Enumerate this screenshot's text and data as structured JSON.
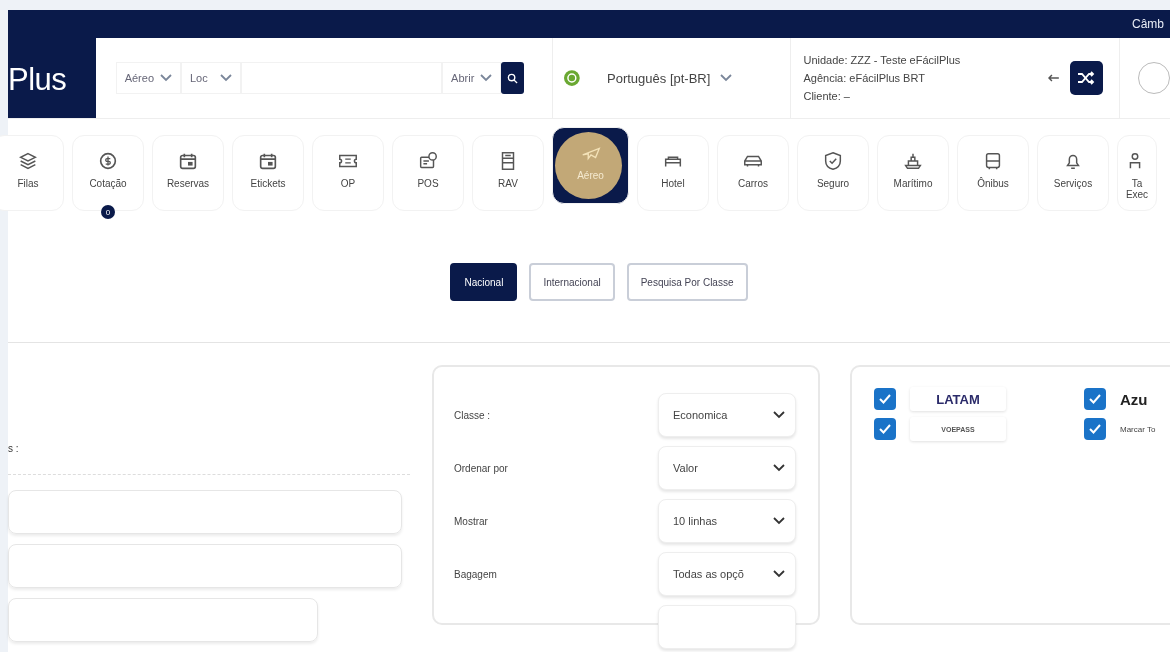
{
  "top_bar": {
    "right_text": "Câmb"
  },
  "logo": {
    "text": "Plus"
  },
  "search": {
    "type_select": "Aéreo",
    "field_select": "Loc",
    "action_select": "Abrir"
  },
  "language": {
    "value": "Português [pt-BR]"
  },
  "unit_info": {
    "unidade": "Unidade:  ZZZ - Teste eFácilPlus",
    "agencia": "Agência: eFácilPlus BRT",
    "cliente": "Cliente:  –"
  },
  "nav": [
    {
      "label": "Filas",
      "kind": "layers",
      "selected": false
    },
    {
      "label": "Cotação",
      "kind": "coin",
      "selected": false,
      "badge": "0"
    },
    {
      "label": "Reservas",
      "kind": "calendar",
      "selected": false
    },
    {
      "label": "Etickets",
      "kind": "calendar",
      "selected": false
    },
    {
      "label": "OP",
      "kind": "ticket",
      "selected": false
    },
    {
      "label": "POS",
      "kind": "pos",
      "selected": false
    },
    {
      "label": "RAV",
      "kind": "doc",
      "selected": false
    },
    {
      "label": "Aéreo",
      "kind": "plane",
      "selected": true
    },
    {
      "label": "Hotel",
      "kind": "bed",
      "selected": false
    },
    {
      "label": "Carros",
      "kind": "car",
      "selected": false
    },
    {
      "label": "Seguro",
      "kind": "shield",
      "selected": false
    },
    {
      "label": "Marítimo",
      "kind": "ship",
      "selected": false
    },
    {
      "label": "Ônibus",
      "kind": "bus",
      "selected": false
    },
    {
      "label": "Serviços",
      "kind": "bell",
      "selected": false
    },
    {
      "label": "Ta Exec",
      "kind": "person",
      "selected": false
    }
  ],
  "scope_tabs": [
    {
      "label": "Nacional",
      "selected": true
    },
    {
      "label": "Internacional",
      "selected": false
    },
    {
      "label": "Pesquisa Por Classe",
      "selected": false
    }
  ],
  "left_panel": {
    "label": "s :"
  },
  "options": [
    {
      "label": "Classe :",
      "value": "Economica"
    },
    {
      "label": "Ordenar por",
      "value": "Valor"
    },
    {
      "label": "Mostrar",
      "value": "10 linhas"
    },
    {
      "label": "Bagagem",
      "value": "Todas as opçõ"
    }
  ],
  "airlines": [
    {
      "kind": "logo",
      "name": "LATAM",
      "checked": true
    },
    {
      "kind": "logo",
      "name": "Azu",
      "checked": true
    },
    {
      "kind": "logo",
      "name": "VOEPASS",
      "checked": true
    },
    {
      "kind": "text",
      "name": "Marcar To",
      "checked": true
    }
  ]
}
